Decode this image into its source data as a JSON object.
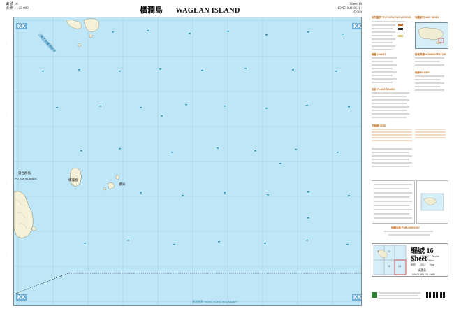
{
  "header": {
    "left_line1": "編 號 16",
    "left_line2": "比 例 1 : 25 000",
    "title_zh": "橫瀾島",
    "title_en": "WAGLAN ISLAND",
    "right_line1": "Sheet 16",
    "right_line2": "HONG KONG 1 : 25 000"
  },
  "map": {
    "kk_label": "KK",
    "islands": [
      {
        "name_zh": "蒲台群島",
        "name_en": "PO TOI ISLANDS"
      },
      {
        "name_zh": "橫瀾島"
      },
      {
        "name_zh": "螺洲"
      }
    ],
    "channel_label": "南丫至螺洲航道",
    "boundary_label": "香港邊界 HONG KONG BOUNDARY"
  },
  "legend": {
    "sections": [
      "地形圖例 TOPOGRAPHIC LEGEND",
      "海圖 CHART",
      "行政界線 ADMINISTRATIVE",
      "地勢 RELIEF",
      "地名 PLACE NAMES",
      "方格網 GRID",
      "地圖索引 MAP INDEX",
      "地圖出版 PUBLISHED BY"
    ]
  },
  "sheet": {
    "title": "編號 16 Sheet",
    "rows": [
      {
        "zh": "編號",
        "value": "HM20C",
        "en": "Series"
      },
      {
        "zh": "版次",
        "value": "10",
        "en": "Edition"
      },
      {
        "zh": "年份",
        "value": "2017",
        "en": "Year"
      }
    ],
    "name_zh": "橫瀾島",
    "name_en": "WAGLAN ISLAND",
    "index_cells": [
      "11",
      "12",
      "",
      "15",
      "16",
      ""
    ]
  },
  "colors": {
    "sea": "#bfe6f6",
    "land": "#f4f1d8",
    "grid": "#9ccbe0",
    "accent": "#c46c1a",
    "depth": "#2a9bb8"
  }
}
